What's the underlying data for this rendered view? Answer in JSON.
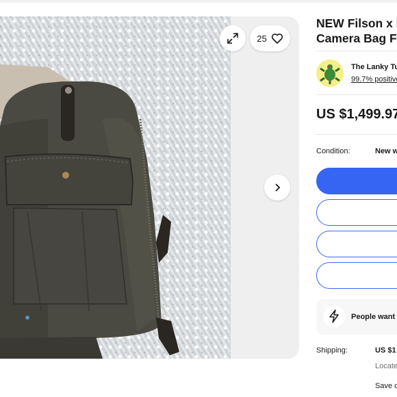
{
  "gallery": {
    "watch_count": "25"
  },
  "listing": {
    "title_line1": "NEW Filson x M",
    "title_line2": "Camera Bag F"
  },
  "seller": {
    "name": "The Lanky Tu",
    "feedback": "99.7% positive"
  },
  "price": "US $1,499.97",
  "condition": {
    "label": "Condition:",
    "value": "New w"
  },
  "urgency": {
    "text": "People want"
  },
  "shipping": {
    "label": "Shipping:",
    "value": "US $1",
    "located": "Locate",
    "save": "Save c"
  },
  "colors": {
    "primary_button": "#3665f3",
    "text": "#191919"
  },
  "icons": [
    "expand-icon",
    "heart-icon",
    "chevron-right-icon",
    "lightning-icon",
    "seller-logo"
  ]
}
